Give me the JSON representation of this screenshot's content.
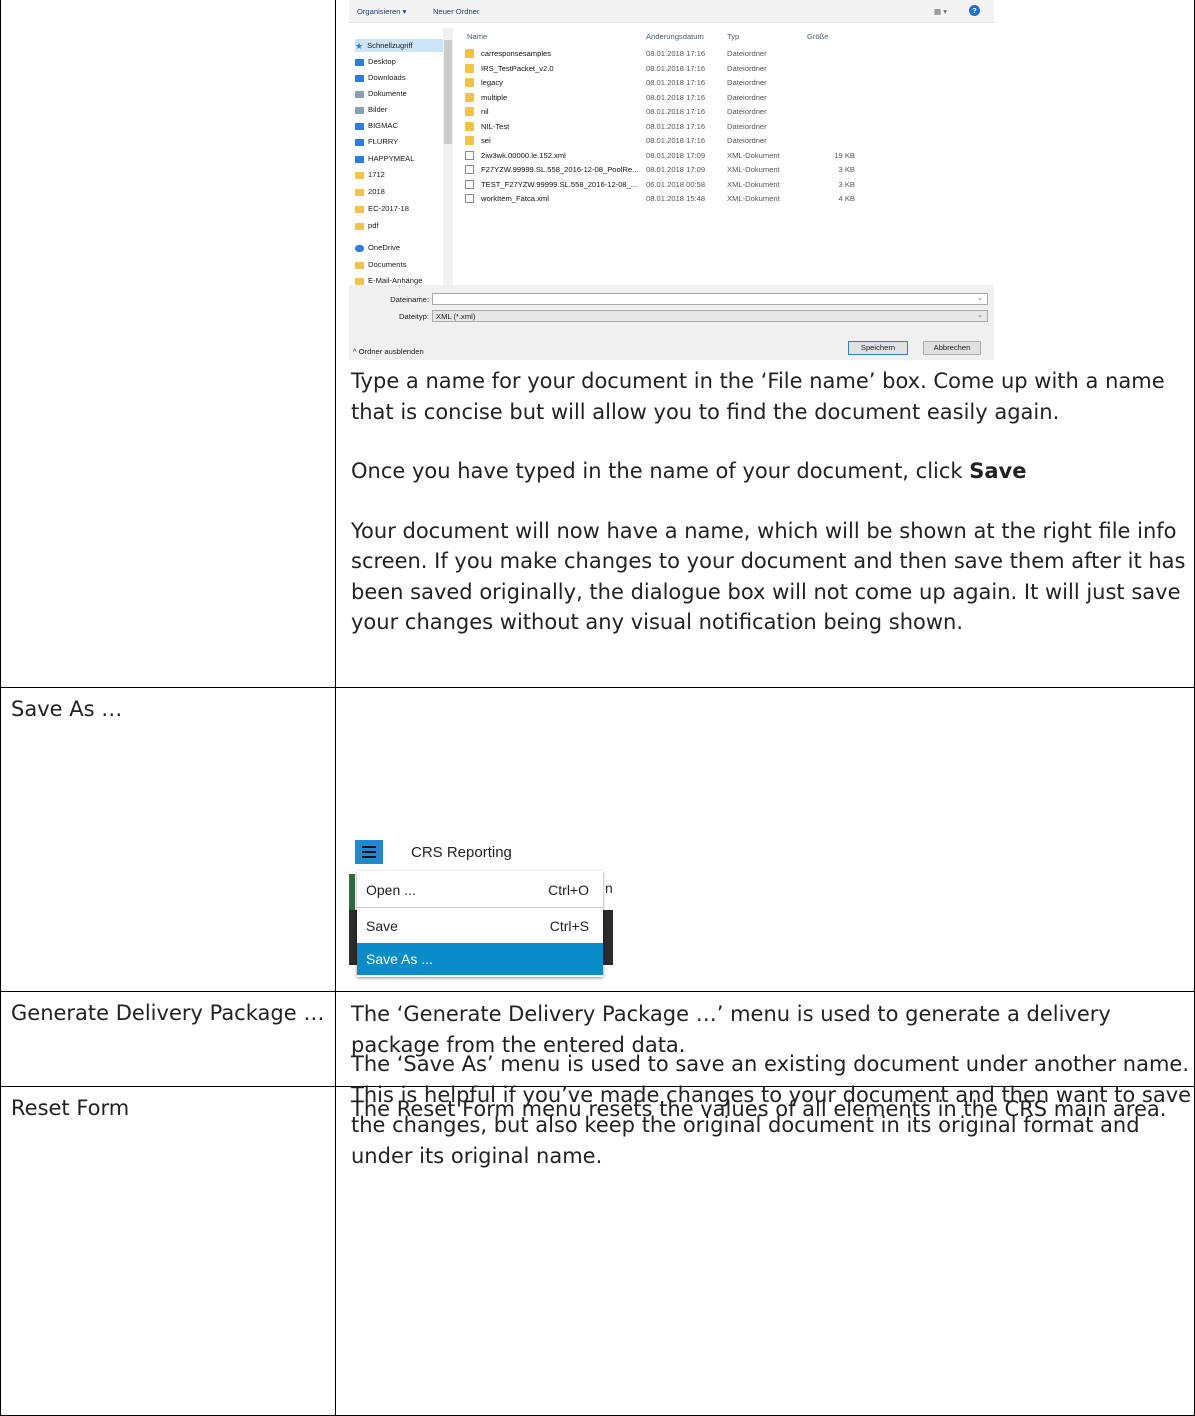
{
  "dialog": {
    "toolbar": {
      "organize": "Organisieren ▾",
      "new_folder": "Neuer Ordner"
    },
    "nav_items": [
      {
        "label": "Schnellzugriff",
        "icon": "star-icon"
      },
      {
        "label": "Desktop",
        "icon": "desktop-icon"
      },
      {
        "label": "Downloads",
        "icon": "download-icon"
      },
      {
        "label": "Dokumente",
        "icon": "document-icon"
      },
      {
        "label": "Bilder",
        "icon": "pictures-icon"
      },
      {
        "label": "BIGMAC",
        "icon": "computer-icon"
      },
      {
        "label": "FLURRY",
        "icon": "computer-icon"
      },
      {
        "label": "HAPPYMEAL",
        "icon": "computer-icon"
      },
      {
        "label": "1712",
        "icon": "folder-icon"
      },
      {
        "label": "2018",
        "icon": "folder-icon"
      },
      {
        "label": "EC-2017-18",
        "icon": "folder-icon"
      },
      {
        "label": "pdf",
        "icon": "folder-icon"
      },
      {
        "label": "OneDrive",
        "icon": "cloud-icon"
      },
      {
        "label": "Documents",
        "icon": "folder-icon"
      },
      {
        "label": "E-Mail-Anhänge",
        "icon": "folder-icon"
      }
    ],
    "columns": {
      "name": "Name",
      "date": "Änderungsdatum",
      "type": "Typ",
      "size": "Größe"
    },
    "files": [
      {
        "name": "carresponsesamples",
        "date": "08.01.2018 17:16",
        "type": "Dateiordner",
        "size": "",
        "kind": "folder"
      },
      {
        "name": "IRS_TestPacket_v2.0",
        "date": "08.01.2018 17:16",
        "type": "Dateiordner",
        "size": "",
        "kind": "folder"
      },
      {
        "name": "legacy",
        "date": "08.01.2018 17:16",
        "type": "Dateiordner",
        "size": "",
        "kind": "folder"
      },
      {
        "name": "multiple",
        "date": "08.01.2018 17:16",
        "type": "Dateiordner",
        "size": "",
        "kind": "folder"
      },
      {
        "name": "nil",
        "date": "08.01.2018 17:16",
        "type": "Dateiordner",
        "size": "",
        "kind": "folder"
      },
      {
        "name": "NIL-Test",
        "date": "08.01.2018 17:16",
        "type": "Dateiordner",
        "size": "",
        "kind": "folder"
      },
      {
        "name": "sei",
        "date": "08.01.2018 17:16",
        "type": "Dateiordner",
        "size": "",
        "kind": "folder"
      },
      {
        "name": "2iw3wk.00000.le.152.xml",
        "date": "08.01.2018 17:09",
        "type": "XML-Dokument",
        "size": "19 KB",
        "kind": "file"
      },
      {
        "name": "F27YZW.99999.SL.558_2016-12-08_PoolRe...",
        "date": "08.01.2018 17:09",
        "type": "XML-Dokument",
        "size": "3 KB",
        "kind": "file"
      },
      {
        "name": "TEST_F27YZW.99999.SL.558_2016-12-08_...",
        "date": "06.01.2018 00:58",
        "type": "XML-Dokument",
        "size": "3 KB",
        "kind": "file"
      },
      {
        "name": "workItem_Fatca.xml",
        "date": "08.01.2018 15:48",
        "type": "XML-Dokument",
        "size": "4 KB",
        "kind": "file"
      }
    ],
    "filename_label": "Dateiname:",
    "filename_value": "",
    "filetype_label": "Dateityp:",
    "filetype_value": "XML (*.xml)",
    "hide_folders": "^ Ordner ausblenden",
    "save_button": "Speichern",
    "cancel_button": "Abbrechen"
  },
  "paragraphs_top": [
    "Type a name for your document in the ‘File name’ box. Come up with a name that is concise but will allow you to find the document easily again.",
    "Once you have typed in the name of your document, click ",
    "Your document will now have a name, which will be shown at the right file info screen. If you make changes to your document and then save them after it has been saved originally, the dialogue box will not come up again. It will just save your changes without any visual notification being shown."
  ],
  "save_word": "Save",
  "menu_shot": {
    "title": "CRS Reporting",
    "items": [
      {
        "label": "Open ...",
        "shortcut": "Ctrl+O"
      },
      {
        "label": "Save",
        "shortcut": "Ctrl+S"
      },
      {
        "label": "Save As ...",
        "shortcut": ""
      }
    ],
    "cut_text": "n"
  },
  "rows": [
    {
      "label": "Save As …",
      "text": "The ‘Save As’ menu is used to save an existing document under another name. This is helpful if you’ve made changes to your document and then want to save the changes, but also keep the original document in its original format and under its original name."
    },
    {
      "label": "Generate Delivery Package …",
      "text": "The ‘Generate Delivery Package …’ menu is used to generate a delivery package from the entered data."
    },
    {
      "label": "Reset Form",
      "text": "The Reset Form menu resets the values of all elements in the CRS main area."
    }
  ],
  "colors": {
    "accent": "#0a8cc9",
    "hamburger": "#1e88d0",
    "border": "#000000"
  }
}
